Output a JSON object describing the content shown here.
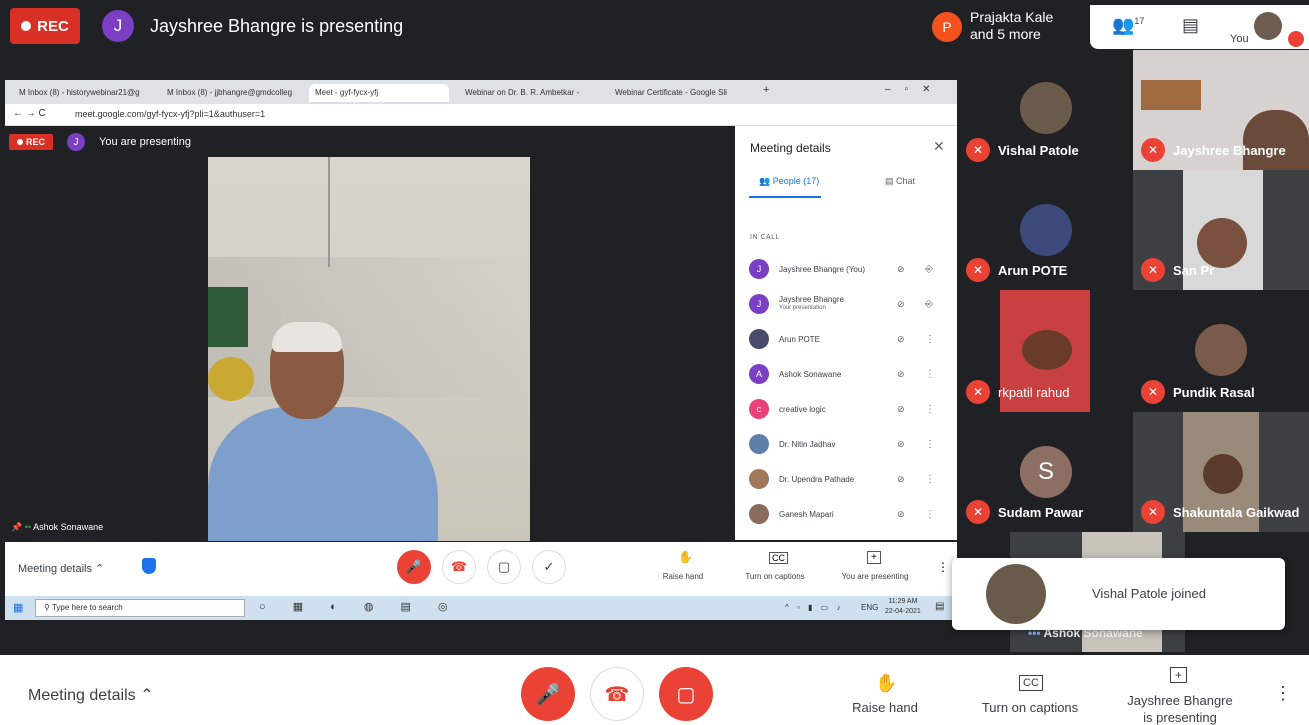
{
  "top_bar": {
    "rec_label": "REC",
    "presenter_initial": "J",
    "presenting_title": "Jayshree Bhangre is presenting",
    "others_initial": "P",
    "others_line1": "Prajakta Kale",
    "others_line2": "and 5 more",
    "people_count": "17",
    "you_label": "You"
  },
  "shared_screen": {
    "tabs": [
      "M Inbox (8) - historywebinar21@g",
      "M Inbox (8) - jjbhangre@gmdcolleg",
      "Meet - gyf-fycx-yfj",
      "Webinar on Dr. B. R. Ambetkar -",
      "Webinar Certificate - Google Sli"
    ],
    "url": "meet.google.com/gyf-fycx-yfj?pli=1&authuser=1",
    "rec_label": "REC",
    "presenter_initial": "J",
    "presenting_label": "You are presenting",
    "speaker_name": "Ashok Sonawane",
    "panel": {
      "title": "Meeting details",
      "people_tab": "People (17)",
      "chat_tab": "Chat",
      "in_call": "IN CALL",
      "participants": [
        {
          "name": "Jayshree Bhangre (You)",
          "sub": "",
          "initial": "J",
          "color": "#7b3fc4"
        },
        {
          "name": "Jayshree Bhangre",
          "sub": "Your presentation",
          "initial": "J",
          "color": "#7b3fc4"
        },
        {
          "name": "Arun POTE",
          "sub": "",
          "initial": "",
          "color": "#4a4a6a"
        },
        {
          "name": "Ashok Sonawane",
          "sub": "",
          "initial": "A",
          "color": "#7b3fc4"
        },
        {
          "name": "creative logic",
          "sub": "",
          "initial": "c",
          "color": "#ec407a"
        },
        {
          "name": "Dr. Nitin Jadhav",
          "sub": "",
          "initial": "",
          "color": "#5f7fa8"
        },
        {
          "name": "Dr. Upendra Pathade",
          "sub": "",
          "initial": "",
          "color": "#a0785a"
        },
        {
          "name": "Ganesh Mapari",
          "sub": "",
          "initial": "",
          "color": "#8a6a5a"
        }
      ]
    },
    "bottom": {
      "details_label": "Meeting details",
      "raise_hand": "Raise hand",
      "captions": "Turn on captions",
      "presenting": "You are presenting"
    },
    "taskbar": {
      "search_placeholder": "Type here to search",
      "lang": "ENG",
      "time": "11:29 AM",
      "date": "22-04-2021"
    }
  },
  "tiles": [
    {
      "name": "Vishal Patole"
    },
    {
      "name": "Jayshree Bhangre"
    },
    {
      "name": "Arun POTE"
    },
    {
      "name": "San Pr"
    },
    {
      "name": "rkpatil rahud"
    },
    {
      "name": "Pundik Rasal"
    },
    {
      "name": "Sudam Pawar",
      "initial": "S"
    },
    {
      "name": "Shakuntala Gaikwad"
    },
    {
      "name": "Ashok Sonawane"
    }
  ],
  "toast": {
    "message": "Vishal Patole joined"
  },
  "bottom_bar": {
    "details_label": "Meeting details",
    "raise_hand": "Raise hand",
    "captions": "Turn on captions",
    "presenting_line1": "Jayshree Bhangre",
    "presenting_line2": "is presenting"
  },
  "colors": {
    "danger": "#ea4335",
    "accent": "#1a73e8",
    "stage": "#202124"
  }
}
